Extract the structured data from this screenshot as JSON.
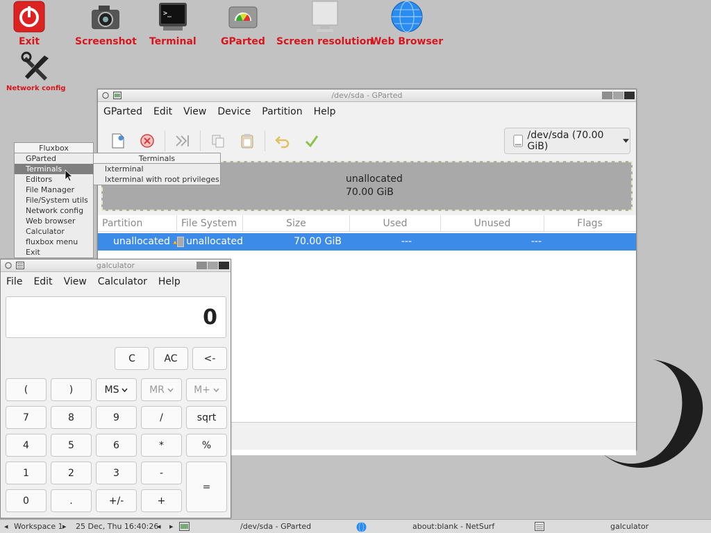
{
  "desktop": {
    "icons": [
      {
        "label": "Exit",
        "icon": "power-icon"
      },
      {
        "label": "Screenshot",
        "icon": "camera-icon"
      },
      {
        "label": "Terminal",
        "icon": "terminal-icon"
      },
      {
        "label": "GParted",
        "icon": "disk-gauge-icon"
      },
      {
        "label": "Screen resolution",
        "icon": "monitor-icon"
      },
      {
        "label": "Web Browser",
        "icon": "globe-icon"
      },
      {
        "label": "Network config",
        "icon": "tools-icon"
      }
    ],
    "label_color": "#d6161c"
  },
  "gparted": {
    "title": "/dev/sda - GParted",
    "menu": [
      "GParted",
      "Edit",
      "View",
      "Device",
      "Partition",
      "Help"
    ],
    "device_selector": "/dev/sda (70.00 GiB)",
    "disk_map": {
      "name": "unallocated",
      "size": "70.00 GiB"
    },
    "columns": [
      "Partition",
      "File System",
      "Size",
      "Used",
      "Unused",
      "Flags"
    ],
    "rows": [
      {
        "partition": "unallocated",
        "filesystem": "unallocated",
        "size": "70.00 GiB",
        "used": "---",
        "unused": "---",
        "flags": ""
      }
    ],
    "selected_row_color": "#3d8be8"
  },
  "fluxbox_menu": {
    "title": "Fluxbox",
    "items": [
      "GParted",
      "Terminals",
      "Editors",
      "File Manager",
      "File/System utils",
      "Network config",
      "Web browser",
      "Calculator",
      "fluxbox menu",
      "Exit"
    ],
    "selected": "Terminals",
    "submenu": {
      "title": "Terminals",
      "items": [
        "lxterminal",
        "lxterminal with root privileges"
      ]
    }
  },
  "calculator": {
    "title": "galculator",
    "menu": [
      "File",
      "Edit",
      "View",
      "Calculator",
      "Help"
    ],
    "display": "0",
    "buttons": {
      "c": "C",
      "ac": "AC",
      "back": "<-",
      "lparen": "(",
      "rparen": ")",
      "ms": "MS",
      "mr": "MR",
      "mplus": "M+",
      "n7": "7",
      "n8": "8",
      "n9": "9",
      "div": "/",
      "sqrt": "sqrt",
      "n4": "4",
      "n5": "5",
      "n6": "6",
      "mul": "*",
      "pct": "%",
      "n1": "1",
      "n2": "2",
      "n3": "3",
      "sub": "-",
      "eq": "=",
      "n0": "0",
      "dot": ".",
      "neg": "+/-",
      "add": "+"
    }
  },
  "taskbar": {
    "workspace": "Workspace 1",
    "clock": "25 Dec, Thu 16:40:26",
    "tasks": [
      "/dev/sda - GParted",
      "about:blank - NetSurf",
      "galculator"
    ]
  }
}
